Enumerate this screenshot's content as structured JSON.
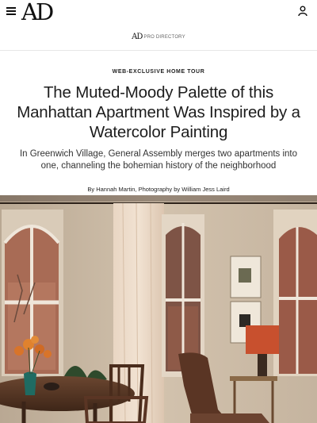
{
  "header": {
    "logo": "AD",
    "menu_icon": "hamburger-menu-icon",
    "account_icon": "user-icon"
  },
  "subheader": {
    "pro_logo_mark": "AD",
    "pro_logo_text": "PRO DIRECTORY"
  },
  "article": {
    "kicker": "WEB-EXCLUSIVE HOME TOUR",
    "headline": "The Muted-Moody Palette of this Manhattan Apartment Was Inspired by a Watercolor Painting",
    "dek": "In Greenwich Village, General Assembly merges two apartments into one, channeling the bohemian history of the neighborhood",
    "byline_prefix": "By ",
    "author": "Hannah Martin",
    "byline_mid": ", Photography by ",
    "photographer": "William Jess Laird"
  },
  "colors": {
    "wall": "#c9b8a4",
    "curtain": "#e8d4c0",
    "brick": "#9a5a48",
    "lamp_shade": "#c8502e",
    "flowers": "#d8742a",
    "vase": "#1f6b62"
  }
}
